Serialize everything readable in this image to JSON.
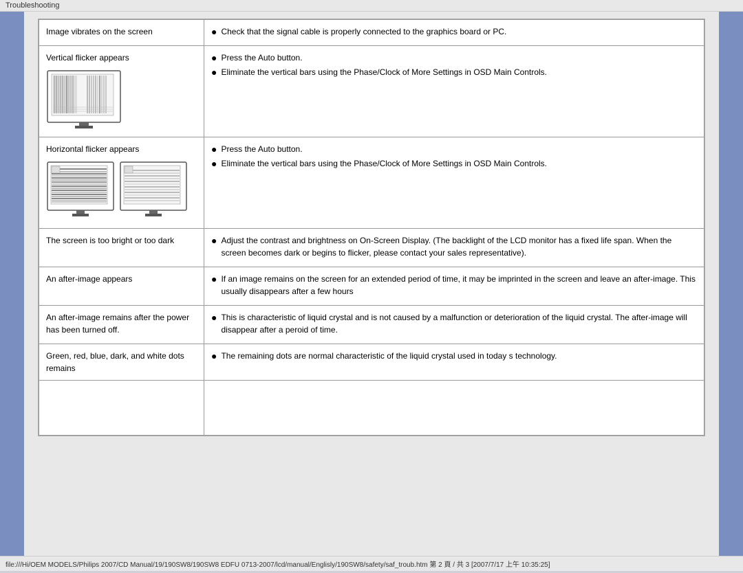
{
  "topbar": {
    "label": "Troubleshooting"
  },
  "statusbar": {
    "text": "file:///Hi/OEM MODELS/Philips 2007/CD Manual/19/190SW8/190SW8 EDFU 0713-2007/lcd/manual/Englisly/190SW8/safety/saf_troub.htm 第 2 頁 / 共 3 [2007/7/17 上午 10:35:25]"
  },
  "rows": [
    {
      "left": "Image vibrates on the screen",
      "right_bullets": [
        "Check that the signal cable is properly connected to the graphics board or PC."
      ],
      "has_image": false,
      "image_type": null
    },
    {
      "left": "Vertical flicker appears",
      "right_bullets": [
        "Press the Auto button.",
        "Eliminate the vertical bars using the Phase/Clock of More Settings in OSD Main Controls."
      ],
      "has_image": true,
      "image_type": "vertical"
    },
    {
      "left": "Horizontal flicker appears",
      "right_bullets": [
        "Press the Auto button.",
        "Eliminate the vertical bars using the Phase/Clock of More Settings in OSD Main Controls."
      ],
      "has_image": true,
      "image_type": "horizontal"
    },
    {
      "left": "The screen is too bright or too dark",
      "right_bullets": [
        "Adjust the contrast and brightness on On-Screen Display. (The backlight of the LCD monitor has a fixed life span. When the screen becomes dark or begins to flicker, please contact your sales representative)."
      ],
      "has_image": false,
      "image_type": null
    },
    {
      "left": "An after-image appears",
      "right_bullets": [
        "If an image remains on the screen for an extended period of time, it may be imprinted in the screen and leave an after-image. This usually disappears after a few hours"
      ],
      "has_image": false,
      "image_type": null
    },
    {
      "left": "An after-image remains after the power has been turned off.",
      "right_bullets": [
        "This is characteristic of liquid crystal and is not caused by a malfunction or deterioration of the liquid crystal. The after-image will disappear after a peroid of time."
      ],
      "has_image": false,
      "image_type": null
    },
    {
      "left": "Green, red, blue, dark, and white dots remains",
      "right_bullets": [
        "The remaining dots are normal characteristic of the liquid crystal used in today s technology."
      ],
      "has_image": false,
      "image_type": null
    }
  ]
}
